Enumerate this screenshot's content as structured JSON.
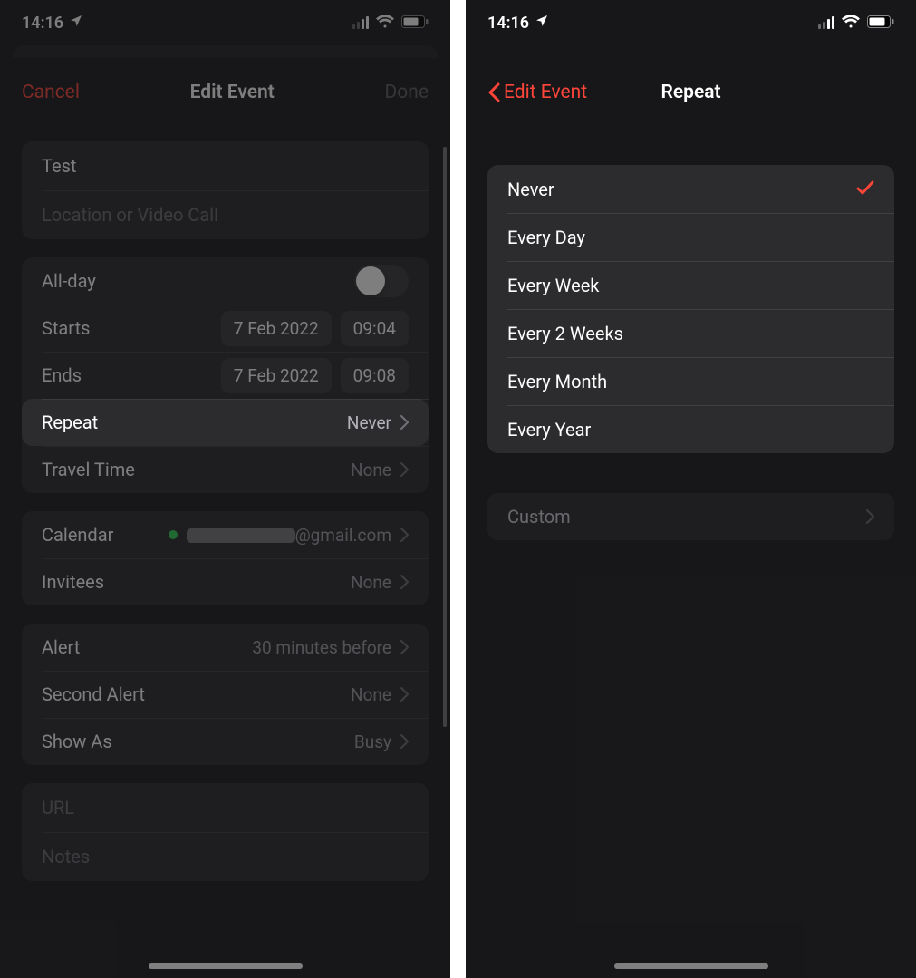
{
  "status": {
    "time": "14:16"
  },
  "left": {
    "nav": {
      "cancel": "Cancel",
      "title": "Edit Event",
      "done": "Done"
    },
    "titleField": {
      "value": "Test",
      "locationPlaceholder": "Location or Video Call"
    },
    "allDay": {
      "label": "All-day",
      "on": false
    },
    "starts": {
      "label": "Starts",
      "date": "7 Feb 2022",
      "time": "09:04"
    },
    "ends": {
      "label": "Ends",
      "date": "7 Feb 2022",
      "time": "09:08"
    },
    "repeat": {
      "label": "Repeat",
      "value": "Never"
    },
    "travel": {
      "label": "Travel Time",
      "value": "None"
    },
    "calendar": {
      "label": "Calendar",
      "emailSuffix": "@gmail.com"
    },
    "invitees": {
      "label": "Invitees",
      "value": "None"
    },
    "alert": {
      "label": "Alert",
      "value": "30 minutes before"
    },
    "secondAlert": {
      "label": "Second Alert",
      "value": "None"
    },
    "showAs": {
      "label": "Show As",
      "value": "Busy"
    },
    "url": {
      "placeholder": "URL"
    },
    "notes": {
      "placeholder": "Notes"
    }
  },
  "right": {
    "nav": {
      "back": "Edit Event",
      "title": "Repeat"
    },
    "options": [
      {
        "label": "Never",
        "selected": true
      },
      {
        "label": "Every Day",
        "selected": false
      },
      {
        "label": "Every Week",
        "selected": false
      },
      {
        "label": "Every 2 Weeks",
        "selected": false
      },
      {
        "label": "Every Month",
        "selected": false
      },
      {
        "label": "Every Year",
        "selected": false
      }
    ],
    "custom": {
      "label": "Custom"
    }
  }
}
